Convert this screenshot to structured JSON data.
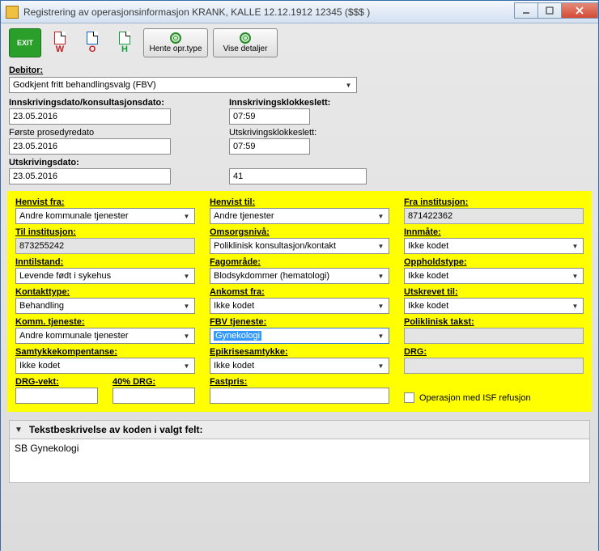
{
  "window": {
    "title": "Registrering av operasjonsinformasjon KRANK, KALLE 12.12.1912 12345 ($$$ )"
  },
  "toolbar": {
    "exit": "EXIT",
    "w": "W",
    "o": "O",
    "h": "H",
    "hente": "Hente opr.type",
    "vise": "Vise detaljer"
  },
  "debitor": {
    "label": "Debitor:",
    "value": "Godkjent fritt behandlingsvalg (FBV)"
  },
  "top": {
    "innskr_dato_label": "Innskrivingsdato/konsultasjonsdato:",
    "innskr_dato": "23.05.2016",
    "innskr_klokke_label": "Innskrivingsklokkeslett:",
    "innskr_klokke": "07:59",
    "forste_label": "Første prosedyredato",
    "forste": "23.05.2016",
    "utskr_klokke_label": "Utskrivingsklokkeslett:",
    "utskr_klokke": "07:59",
    "utskr_dato_label": "Utskrivingsdato:",
    "utskr_dato": "23.05.2016",
    "extra": "41"
  },
  "y": {
    "henvist_fra_label": "Henvist fra:",
    "henvist_fra": "Andre kommunale tjenester",
    "henvist_til_label": "Henvist til:",
    "henvist_til": "Andre tjenester",
    "fra_inst_label": "Fra institusjon:",
    "fra_inst": "871422362",
    "til_inst_label": "Til institusjon:",
    "til_inst": "873255242",
    "omsorg_label": "Omsorgsnivå:",
    "omsorg": "Poliklinisk konsultasjon/kontakt",
    "innmate_label": "Innmåte:",
    "innmate": "Ikke kodet",
    "inntilstand_label": "Inntilstand:",
    "inntilstand": "Levende født i sykehus",
    "fagomrade_label": "Fagområde:",
    "fagomrade": "Blodsykdommer (hematologi)",
    "oppholdstype_label": "Oppholdstype:",
    "oppholdstype": "Ikke kodet",
    "kontakttype_label": "Kontakttype:",
    "kontakttype": "Behandling",
    "ankomst_label": "Ankomst fra:",
    "ankomst": "Ikke kodet",
    "utskrevet_label": "Utskrevet til:",
    "utskrevet": "Ikke kodet",
    "komm_label": "Komm. tjeneste:",
    "komm": "Andre kommunale tjenester",
    "fbv_label": "FBV tjeneste:",
    "fbv": "Gynekologi",
    "poliklinisk_label": "Poliklinisk takst:",
    "poliklinisk": "",
    "samtykke_label": "Samtykkekompentanse:",
    "samtykke": "Ikke kodet",
    "epikrise_label": "Epikrisesamtykke:",
    "epikrise": "Ikke kodet",
    "drg_label": "DRG:",
    "drg": "",
    "drgvekt_label": "DRG-vekt:",
    "drg40_label": "40% DRG:",
    "fastpris_label": "Fastpris:",
    "isf_label": "Operasjon med ISF refusjon"
  },
  "desc": {
    "header": "Tekstbeskrivelse av koden i valgt felt:",
    "body": "SB Gynekologi"
  }
}
